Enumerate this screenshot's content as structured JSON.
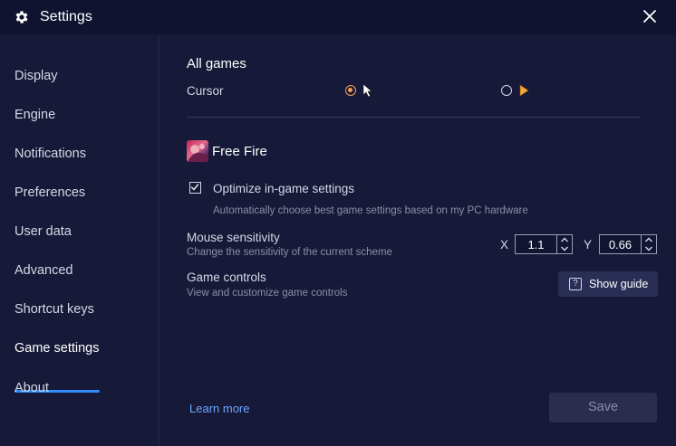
{
  "window": {
    "title": "Settings"
  },
  "sidebar": {
    "items": [
      {
        "label": "Display"
      },
      {
        "label": "Engine"
      },
      {
        "label": "Notifications"
      },
      {
        "label": "Preferences"
      },
      {
        "label": "User data"
      },
      {
        "label": "Advanced"
      },
      {
        "label": "Shortcut keys"
      },
      {
        "label": "Game settings",
        "active": true
      },
      {
        "label": "About"
      }
    ]
  },
  "main": {
    "section_title": "All games",
    "cursor": {
      "label": "Cursor",
      "selected_option": 0
    },
    "game": {
      "name": "Free Fire",
      "optimize": {
        "checked": true,
        "label": "Optimize in-game settings",
        "description": "Automatically choose best game settings based on my PC hardware"
      },
      "mouse_sensitivity": {
        "label": "Mouse sensitivity",
        "description": "Change the sensitivity of the current scheme",
        "x_label": "X",
        "x_value": "1.1",
        "y_label": "Y",
        "y_value": "0.66"
      },
      "game_controls": {
        "label": "Game controls",
        "description": "View and customize game controls",
        "button_label": "Show guide"
      }
    },
    "learn_more": "Learn more",
    "save_label": "Save"
  },
  "colors": {
    "background": "#161938",
    "titlebar": "#0f1330",
    "accent": "#2f8cff",
    "radio_selected": "#f5a05a",
    "link": "#6fa7ff"
  },
  "icons": [
    "gear-icon",
    "close-icon",
    "mouse-pointer-icon",
    "game-cursor-icon",
    "checkmark-icon",
    "question-icon",
    "chevron-up-icon",
    "chevron-down-icon"
  ]
}
